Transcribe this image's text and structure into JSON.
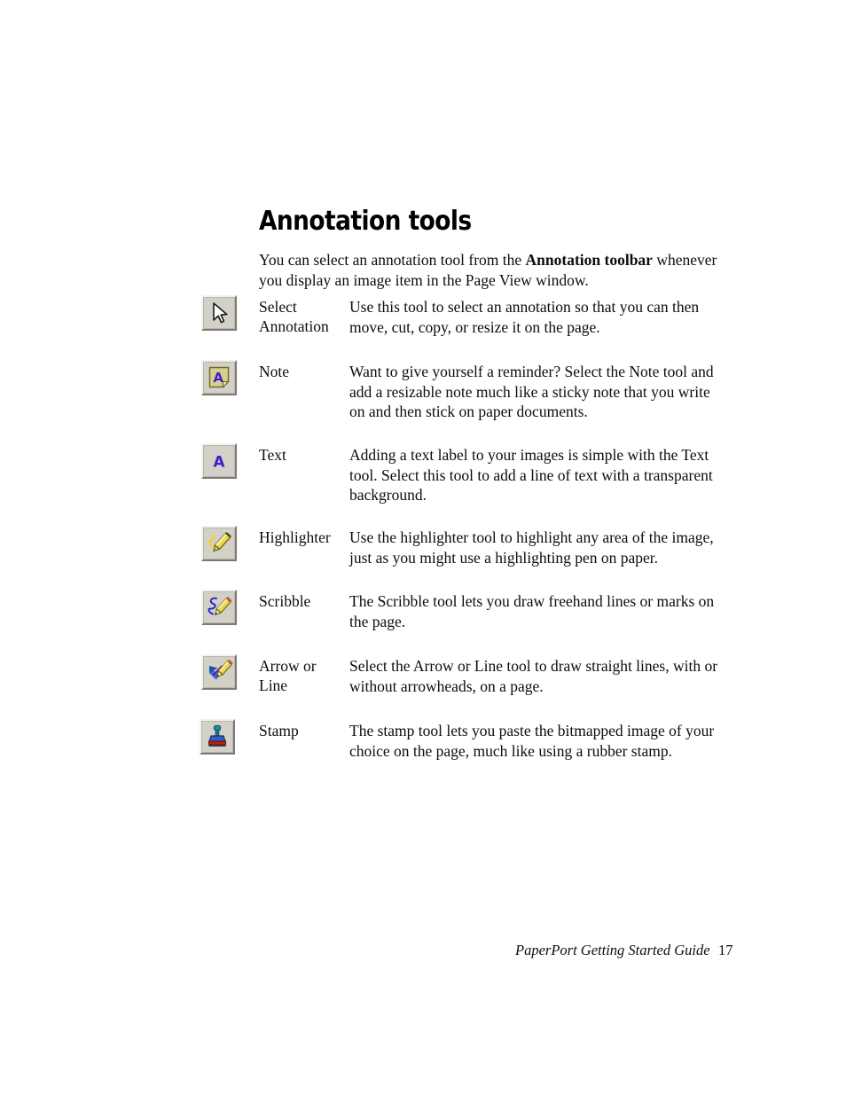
{
  "heading": "Annotation tools",
  "intro": {
    "part1": "You can select an annotation tool from the ",
    "bold": "Annotation toolbar",
    "part2": " whenever you display an image item in the Page View window."
  },
  "tools": [
    {
      "icon": "select-annotation-icon",
      "label": "Select Annotation",
      "description": "Use this tool to select an annotation so that you can then move, cut, copy, or resize it on the page."
    },
    {
      "icon": "note-icon",
      "label": "Note",
      "description": "Want to give yourself a reminder? Select the Note tool and add a resizable note much like a sticky note that you write on and then stick on paper documents."
    },
    {
      "icon": "text-icon",
      "label": "Text",
      "description": "Adding a text label to your images is simple with the Text tool. Select this tool to add a line of text with a transparent background."
    },
    {
      "icon": "highlighter-icon",
      "label": "Highlighter",
      "description": "Use the highlighter tool to highlight any area of the image, just as you might use a highlighting pen on paper."
    },
    {
      "icon": "scribble-icon",
      "label": "Scribble",
      "description": "The Scribble tool lets you draw freehand lines or marks on the page."
    },
    {
      "icon": "arrow-or-line-icon",
      "label": "Arrow or Line",
      "description": "Select the Arrow or Line tool to draw straight lines, with or without arrowheads, on a page."
    },
    {
      "icon": "stamp-icon",
      "label": "Stamp",
      "description": "The stamp tool lets you paste the bitmapped image of your choice on the page, much like using a rubber stamp."
    }
  ],
  "footer": {
    "title": "PaperPort Getting Started Guide",
    "page": "17"
  },
  "colors": {
    "button_face": "#d3d0c8",
    "button_highlight": "#f3f2ee",
    "button_shadow": "#7d7a73",
    "note_yellow": "#d8cf8a",
    "glyph_blue": "#3d1fd0",
    "pencil_yellow": "#e8d84a",
    "stamp_red": "#b82010",
    "stamp_teal": "#1a7a86"
  }
}
